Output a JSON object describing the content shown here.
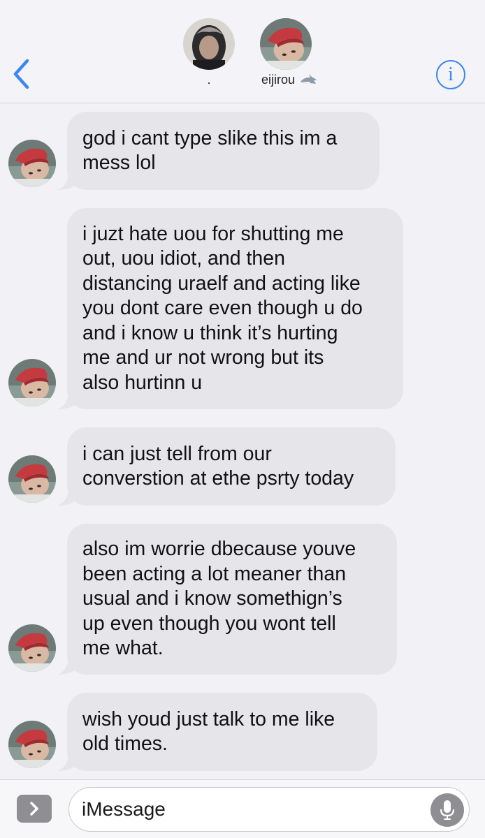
{
  "header": {
    "contacts": [
      {
        "name": "."
      },
      {
        "name": "eijirou"
      }
    ]
  },
  "messages": [
    {
      "text": "god i cant type slike this im a\nmess lol"
    },
    {
      "text": "i juzt hate uou for shutting me\nout, uou idiot, and then\ndistancing uraelf and acting like\nyou dont care even though u do\nand i know u think it’s hurting\nme and ur not wrong but its\nalso hurtinn u"
    },
    {
      "text": "i can just tell from our\nconverstion at ethe psrty today"
    },
    {
      "text": "also im worrie dbecause youve\nbeen acting a lot meaner than\nusual and i know somethign’s\nup even though you wont tell\nme what."
    },
    {
      "text": "wish youd just talk to me like\nold times."
    }
  ],
  "composer": {
    "placeholder": "iMessage"
  },
  "colors": {
    "accent": "#3b86f0",
    "bubble": "#e6e5ea",
    "background": "#f2f1f6"
  }
}
